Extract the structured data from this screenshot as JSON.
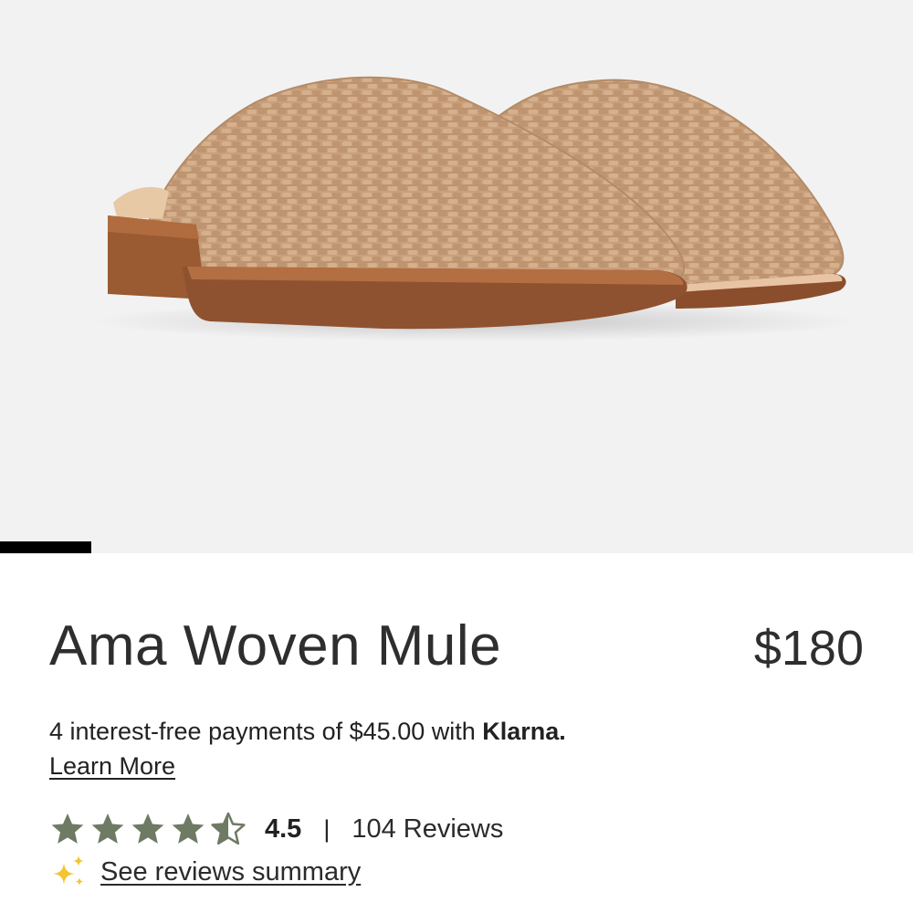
{
  "product": {
    "title": "Ama Woven Mule",
    "price": "$180"
  },
  "financing": {
    "text": "4 interest-free payments of $45.00 with ",
    "brand": "Klarna.",
    "learn_more": "Learn More"
  },
  "rating": {
    "value": "4.5",
    "stars": 4.5,
    "max_stars": 5,
    "separator": "|",
    "reviews": "104 Reviews",
    "summary_link": "See reviews summary"
  },
  "carousel": {
    "active_index": 0,
    "indicator_fraction": 0.1
  },
  "colors": {
    "star": "#6e7a63",
    "sparkle": "#f2c531",
    "hero_background": "#f2f2f3",
    "shoe_leather": "#caa07a",
    "shoe_sole": "#8a4e2c"
  },
  "icons": {
    "star_full": "star-icon",
    "star_half": "star-half-icon",
    "sparkle": "sparkle-icon"
  }
}
